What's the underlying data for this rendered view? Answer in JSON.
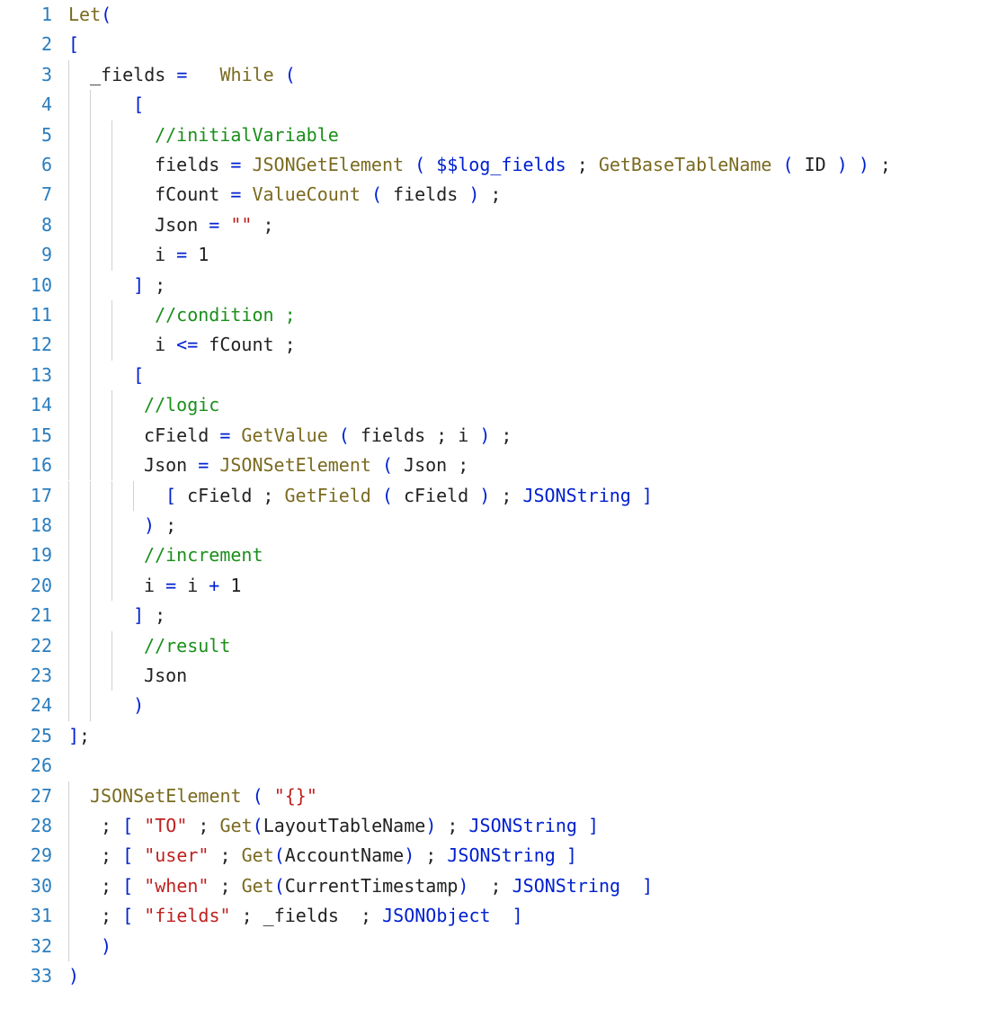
{
  "lines": [
    {
      "n": "1",
      "indent": 0,
      "tokens": [
        [
          "fn",
          "Let"
        ],
        [
          "kw",
          "("
        ]
      ]
    },
    {
      "n": "2",
      "indent": 0,
      "tokens": [
        [
          "kw",
          "["
        ]
      ]
    },
    {
      "n": "3",
      "indent": 1,
      "tokens": [
        [
          "op",
          "_fields "
        ],
        [
          "kw",
          "="
        ],
        [
          "op",
          "   "
        ],
        [
          "fn",
          "While"
        ],
        [
          "op",
          " "
        ],
        [
          "kw",
          "("
        ]
      ]
    },
    {
      "n": "4",
      "indent": 2,
      "tokens": [
        [
          "op",
          "  "
        ],
        [
          "kw",
          "["
        ]
      ]
    },
    {
      "n": "5",
      "indent": 3,
      "tokens": [
        [
          "op",
          "  "
        ],
        [
          "cm",
          "//initialVariable"
        ]
      ]
    },
    {
      "n": "6",
      "indent": 3,
      "tokens": [
        [
          "op",
          "  fields "
        ],
        [
          "kw",
          "="
        ],
        [
          "op",
          " "
        ],
        [
          "fn",
          "JSONGetElement"
        ],
        [
          "op",
          " "
        ],
        [
          "kw",
          "("
        ],
        [
          "op",
          " "
        ],
        [
          "gv",
          "$$log_fields"
        ],
        [
          "op",
          " ; "
        ],
        [
          "fn",
          "GetBaseTableName"
        ],
        [
          "op",
          " "
        ],
        [
          "kw",
          "("
        ],
        [
          "op",
          " ID "
        ],
        [
          "kw",
          ")"
        ],
        [
          "op",
          " "
        ],
        [
          "kw",
          ")"
        ],
        [
          "op",
          " ;"
        ]
      ]
    },
    {
      "n": "7",
      "indent": 3,
      "tokens": [
        [
          "op",
          "  fCount "
        ],
        [
          "kw",
          "="
        ],
        [
          "op",
          " "
        ],
        [
          "fn",
          "ValueCount"
        ],
        [
          "op",
          " "
        ],
        [
          "kw",
          "("
        ],
        [
          "op",
          " fields "
        ],
        [
          "kw",
          ")"
        ],
        [
          "op",
          " ;"
        ]
      ]
    },
    {
      "n": "8",
      "indent": 3,
      "tokens": [
        [
          "op",
          "  Json "
        ],
        [
          "kw",
          "="
        ],
        [
          "op",
          " "
        ],
        [
          "str",
          "\"\""
        ],
        [
          "op",
          " ;"
        ]
      ]
    },
    {
      "n": "9",
      "indent": 3,
      "tokens": [
        [
          "op",
          "  i "
        ],
        [
          "kw",
          "="
        ],
        [
          "op",
          " "
        ],
        [
          "num",
          "1"
        ]
      ]
    },
    {
      "n": "10",
      "indent": 2,
      "tokens": [
        [
          "op",
          "  "
        ],
        [
          "kw",
          "]"
        ],
        [
          "op",
          " ;"
        ]
      ]
    },
    {
      "n": "11",
      "indent": 3,
      "tokens": [
        [
          "op",
          "  "
        ],
        [
          "cm",
          "//condition ;"
        ]
      ]
    },
    {
      "n": "12",
      "indent": 3,
      "tokens": [
        [
          "op",
          "  i "
        ],
        [
          "kw",
          "<="
        ],
        [
          "op",
          " fCount ;"
        ]
      ]
    },
    {
      "n": "13",
      "indent": 2,
      "tokens": [
        [
          "op",
          "  "
        ],
        [
          "kw",
          "["
        ]
      ]
    },
    {
      "n": "14",
      "indent": 3,
      "tokens": [
        [
          "op",
          " "
        ],
        [
          "cm",
          "//logic"
        ]
      ]
    },
    {
      "n": "15",
      "indent": 3,
      "tokens": [
        [
          "op",
          " cField "
        ],
        [
          "kw",
          "="
        ],
        [
          "op",
          " "
        ],
        [
          "fn",
          "GetValue"
        ],
        [
          "op",
          " "
        ],
        [
          "kw",
          "("
        ],
        [
          "op",
          " fields ; i "
        ],
        [
          "kw",
          ")"
        ],
        [
          "op",
          " ;"
        ]
      ]
    },
    {
      "n": "16",
      "indent": 3,
      "tokens": [
        [
          "op",
          " Json "
        ],
        [
          "kw",
          "="
        ],
        [
          "op",
          " "
        ],
        [
          "fn",
          "JSONSetElement"
        ],
        [
          "op",
          " "
        ],
        [
          "kw",
          "("
        ],
        [
          "op",
          " Json ;"
        ]
      ]
    },
    {
      "n": "17",
      "indent": 4,
      "tokens": [
        [
          "op",
          " "
        ],
        [
          "kw",
          "["
        ],
        [
          "op",
          " cField ; "
        ],
        [
          "fn",
          "GetField"
        ],
        [
          "op",
          " "
        ],
        [
          "kw",
          "("
        ],
        [
          "op",
          " cField "
        ],
        [
          "kw",
          ")"
        ],
        [
          "op",
          " ; "
        ],
        [
          "gv",
          "JSONString"
        ],
        [
          "op",
          " "
        ],
        [
          "kw",
          "]"
        ]
      ]
    },
    {
      "n": "18",
      "indent": 3,
      "tokens": [
        [
          "op",
          " "
        ],
        [
          "kw",
          ")"
        ],
        [
          "op",
          " ;"
        ]
      ]
    },
    {
      "n": "19",
      "indent": 3,
      "tokens": [
        [
          "op",
          " "
        ],
        [
          "cm",
          "//increment"
        ]
      ]
    },
    {
      "n": "20",
      "indent": 3,
      "tokens": [
        [
          "op",
          " i "
        ],
        [
          "kw",
          "="
        ],
        [
          "op",
          " i "
        ],
        [
          "kw",
          "+"
        ],
        [
          "op",
          " "
        ],
        [
          "num",
          "1"
        ]
      ]
    },
    {
      "n": "21",
      "indent": 2,
      "tokens": [
        [
          "op",
          "  "
        ],
        [
          "kw",
          "]"
        ],
        [
          "op",
          " ;"
        ]
      ]
    },
    {
      "n": "22",
      "indent": 3,
      "tokens": [
        [
          "op",
          " "
        ],
        [
          "cm",
          "//result"
        ]
      ]
    },
    {
      "n": "23",
      "indent": 3,
      "tokens": [
        [
          "op",
          " Json"
        ]
      ]
    },
    {
      "n": "24",
      "indent": 2,
      "tokens": [
        [
          "op",
          "  "
        ],
        [
          "kw",
          ")"
        ]
      ]
    },
    {
      "n": "25",
      "indent": 0,
      "tokens": [
        [
          "kw",
          "]"
        ],
        [
          "op",
          ";"
        ]
      ]
    },
    {
      "n": "26",
      "indent": 0,
      "tokens": []
    },
    {
      "n": "27",
      "indent": 1,
      "tokens": [
        [
          "fn",
          "JSONSetElement"
        ],
        [
          "op",
          " "
        ],
        [
          "kw",
          "("
        ],
        [
          "op",
          " "
        ],
        [
          "str",
          "\"{}\""
        ]
      ]
    },
    {
      "n": "28",
      "indent": 1,
      "tokens": [
        [
          "op",
          " ; "
        ],
        [
          "kw",
          "["
        ],
        [
          "op",
          " "
        ],
        [
          "str",
          "\"TO\""
        ],
        [
          "op",
          " ; "
        ],
        [
          "fn",
          "Get"
        ],
        [
          "kw",
          "("
        ],
        [
          "op",
          "LayoutTableName"
        ],
        [
          "kw",
          ")"
        ],
        [
          "op",
          " ; "
        ],
        [
          "gv",
          "JSONString"
        ],
        [
          "op",
          " "
        ],
        [
          "kw",
          "]"
        ]
      ]
    },
    {
      "n": "29",
      "indent": 1,
      "tokens": [
        [
          "op",
          " ; "
        ],
        [
          "kw",
          "["
        ],
        [
          "op",
          " "
        ],
        [
          "str",
          "\"user\""
        ],
        [
          "op",
          " ; "
        ],
        [
          "fn",
          "Get"
        ],
        [
          "kw",
          "("
        ],
        [
          "op",
          "AccountName"
        ],
        [
          "kw",
          ")"
        ],
        [
          "op",
          " ; "
        ],
        [
          "gv",
          "JSONString"
        ],
        [
          "op",
          " "
        ],
        [
          "kw",
          "]"
        ]
      ]
    },
    {
      "n": "30",
      "indent": 1,
      "tokens": [
        [
          "op",
          " ; "
        ],
        [
          "kw",
          "["
        ],
        [
          "op",
          " "
        ],
        [
          "str",
          "\"when\""
        ],
        [
          "op",
          " ; "
        ],
        [
          "fn",
          "Get"
        ],
        [
          "kw",
          "("
        ],
        [
          "op",
          "CurrentTimestamp"
        ],
        [
          "kw",
          ")"
        ],
        [
          "op",
          "  ; "
        ],
        [
          "gv",
          "JSONString"
        ],
        [
          "op",
          "  "
        ],
        [
          "kw",
          "]"
        ]
      ]
    },
    {
      "n": "31",
      "indent": 1,
      "tokens": [
        [
          "op",
          " ; "
        ],
        [
          "kw",
          "["
        ],
        [
          "op",
          " "
        ],
        [
          "str",
          "\"fields\""
        ],
        [
          "op",
          " ; _fields  ; "
        ],
        [
          "gv",
          "JSONObject"
        ],
        [
          "op",
          "  "
        ],
        [
          "kw",
          "]"
        ]
      ]
    },
    {
      "n": "32",
      "indent": 1,
      "tokens": [
        [
          "op",
          " "
        ],
        [
          "kw",
          ")"
        ]
      ]
    },
    {
      "n": "33",
      "indent": 0,
      "tokens": [
        [
          "kw",
          ")"
        ]
      ]
    }
  ],
  "gutterUnit": 12
}
